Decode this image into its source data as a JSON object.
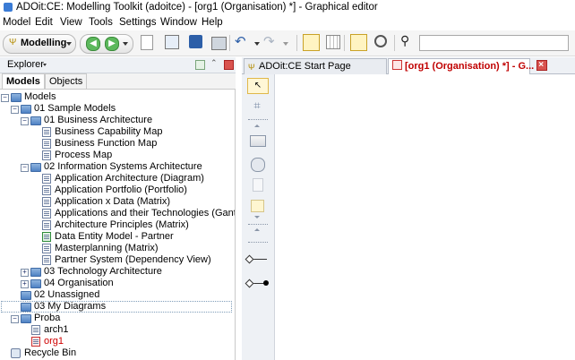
{
  "window": {
    "title": "ADOit:CE: Modelling Toolkit (adoitce) - [org1 (Organisation) *] - Graphical editor"
  },
  "menu": [
    "Model",
    "Edit",
    "View",
    "Tools",
    "Settings",
    "Window",
    "Help"
  ],
  "toolbar": {
    "mode_label": "Modelling",
    "search_value": ""
  },
  "explorer": {
    "header": "Explorer",
    "tabs": [
      "Models",
      "Objects"
    ],
    "active_tab": "Models",
    "tree": [
      {
        "label": "Models",
        "type": "folder",
        "level": 0,
        "expanded": true
      },
      {
        "label": "01 Sample Models",
        "type": "folder",
        "level": 1,
        "expanded": true
      },
      {
        "label": "01 Business Architecture",
        "type": "folder",
        "level": 2,
        "expanded": true
      },
      {
        "label": "Business Capability Map",
        "type": "model",
        "level": 3
      },
      {
        "label": "Business Function Map",
        "type": "model",
        "level": 3
      },
      {
        "label": "Process Map",
        "type": "model",
        "level": 3
      },
      {
        "label": "02 Information Systems Architecture",
        "type": "folder",
        "level": 2,
        "expanded": true
      },
      {
        "label": "Application Architecture (Diagram)",
        "type": "model",
        "level": 3
      },
      {
        "label": "Application Portfolio (Portfolio)",
        "type": "model",
        "level": 3
      },
      {
        "label": "Application x Data (Matrix)",
        "type": "model",
        "level": 3
      },
      {
        "label": "Applications and their Technologies (Gantt)",
        "type": "model",
        "level": 3
      },
      {
        "label": "Architecture Principles (Matrix)",
        "type": "model",
        "level": 3
      },
      {
        "label": "Data Entity Model - Partner",
        "type": "model-green",
        "level": 3
      },
      {
        "label": "Masterplanning (Matrix)",
        "type": "model",
        "level": 3
      },
      {
        "label": "Partner System (Dependency View)",
        "type": "model",
        "level": 3
      },
      {
        "label": "03 Technology Architecture",
        "type": "folder",
        "level": 2,
        "expanded": false
      },
      {
        "label": "04 Organisation",
        "type": "folder",
        "level": 2,
        "expanded": false
      },
      {
        "label": "02 Unassigned",
        "type": "folder",
        "level": 1
      },
      {
        "label": "03 My Diagrams",
        "type": "folder",
        "level": 1,
        "selected": true
      },
      {
        "label": "Proba",
        "type": "folder",
        "level": 1,
        "expanded": true
      },
      {
        "label": "arch1",
        "type": "model",
        "level": 2
      },
      {
        "label": "org1",
        "type": "model-red",
        "level": 2,
        "color": "#d00000"
      },
      {
        "label": "Recycle Bin",
        "type": "recycle",
        "level": 0
      }
    ]
  },
  "tabs": [
    {
      "label": "ADOit:CE Start Page",
      "active": false
    },
    {
      "label": "[org1 (Organisation) *] - G...",
      "active": true
    }
  ],
  "colors": {
    "active_tab_text": "#c00000",
    "panel_bg": "#eef1f5",
    "folder_blue": "#4f82c4"
  }
}
